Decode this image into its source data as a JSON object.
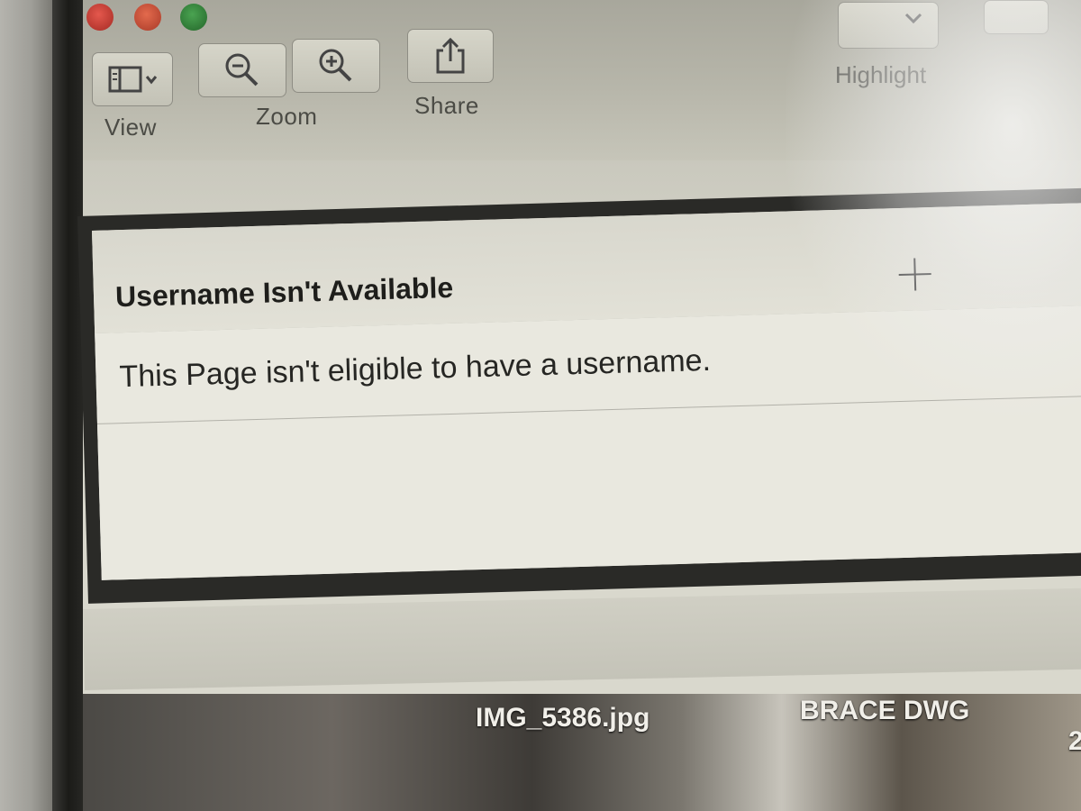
{
  "toolbar": {
    "view_label": "View",
    "zoom_label": "Zoom",
    "share_label": "Share",
    "highlight_label": "Highlight",
    "icons": {
      "view": "sidebar-view-icon",
      "zoom_out": "zoom-out-icon",
      "zoom_in": "zoom-in-icon",
      "share": "share-icon"
    }
  },
  "dialog": {
    "title": "Username Isn't Available",
    "message": "This Page isn't eligible to have a username.",
    "plus_icon": "plus-icon"
  },
  "files": [
    {
      "name": "IMG_5386.jpg"
    },
    {
      "name": "BRACE DWG"
    },
    {
      "name": "2"
    }
  ],
  "colors": {
    "window_red": "#d4473d",
    "window_yellow": "#d75b40",
    "window_green": "#3f8d46"
  }
}
